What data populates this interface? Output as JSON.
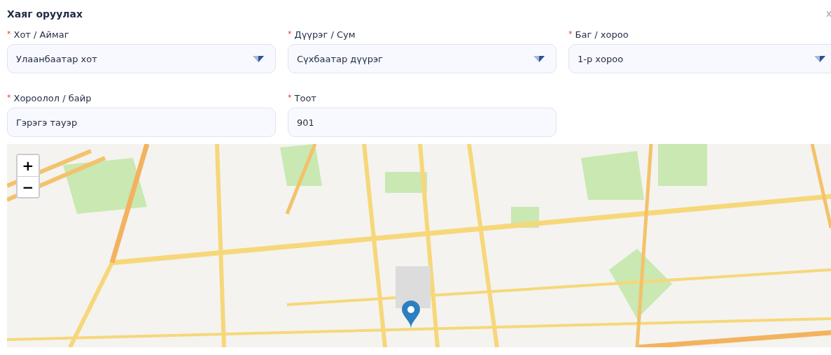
{
  "title": "Хаяг оруулах",
  "fields": [
    {
      "kind": "select",
      "label": "Хот / Аймаг",
      "required": "*",
      "value": "Улаанбаатар хот"
    },
    {
      "kind": "select",
      "label": "Дүүрэг / Сум",
      "required": "*",
      "value": "Сүхбаатар дүүрэг"
    },
    {
      "kind": "select",
      "label": "Баг / хороо",
      "required": "*",
      "value": "1-р хороо"
    },
    {
      "kind": "text",
      "label": "Хороолол / байр",
      "required": "*",
      "value": "Гэрэгэ тауэр"
    },
    {
      "kind": "text",
      "label": "Тоот",
      "required": "*",
      "value": "901"
    }
  ],
  "map": {
    "zoom_in": "+",
    "zoom_out": "−"
  }
}
